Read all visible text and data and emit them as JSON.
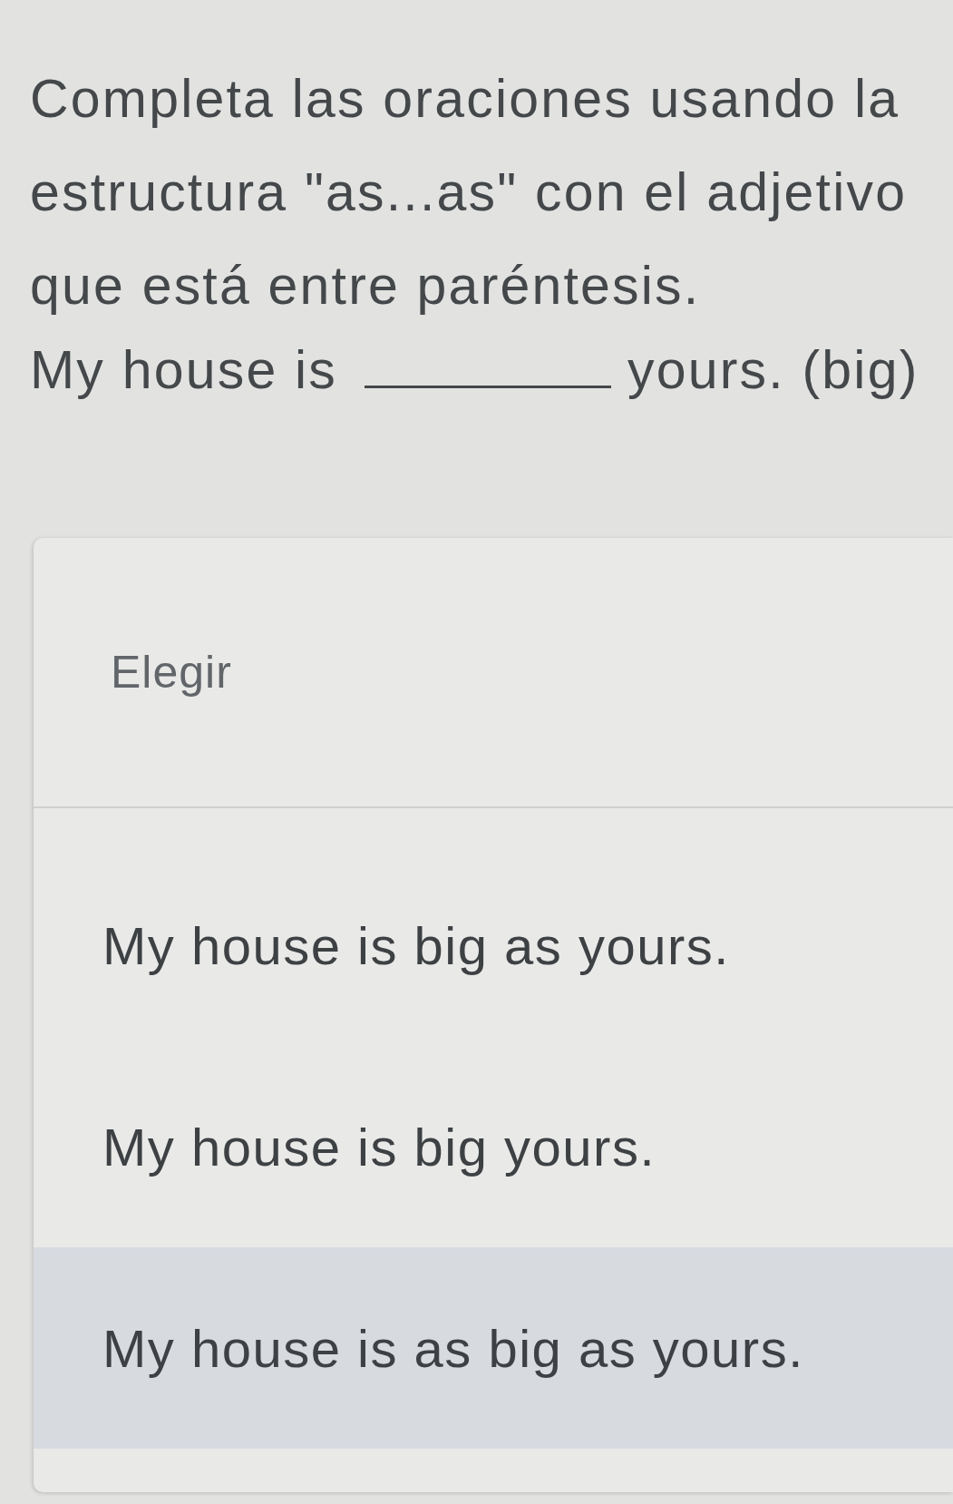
{
  "question": {
    "instruction": "Completa las oraciones usando la estructura \"as...as\" con el adjetivo que está entre paréntesis.",
    "sentence_start": "My house is",
    "sentence_end": "yours. (big)"
  },
  "dropdown": {
    "placeholder": "Elegir",
    "options": [
      {
        "label": "My house is big as yours.",
        "selected": false
      },
      {
        "label": "My house is big yours.",
        "selected": false
      },
      {
        "label": "My house is as big as yours.",
        "selected": true
      }
    ]
  }
}
